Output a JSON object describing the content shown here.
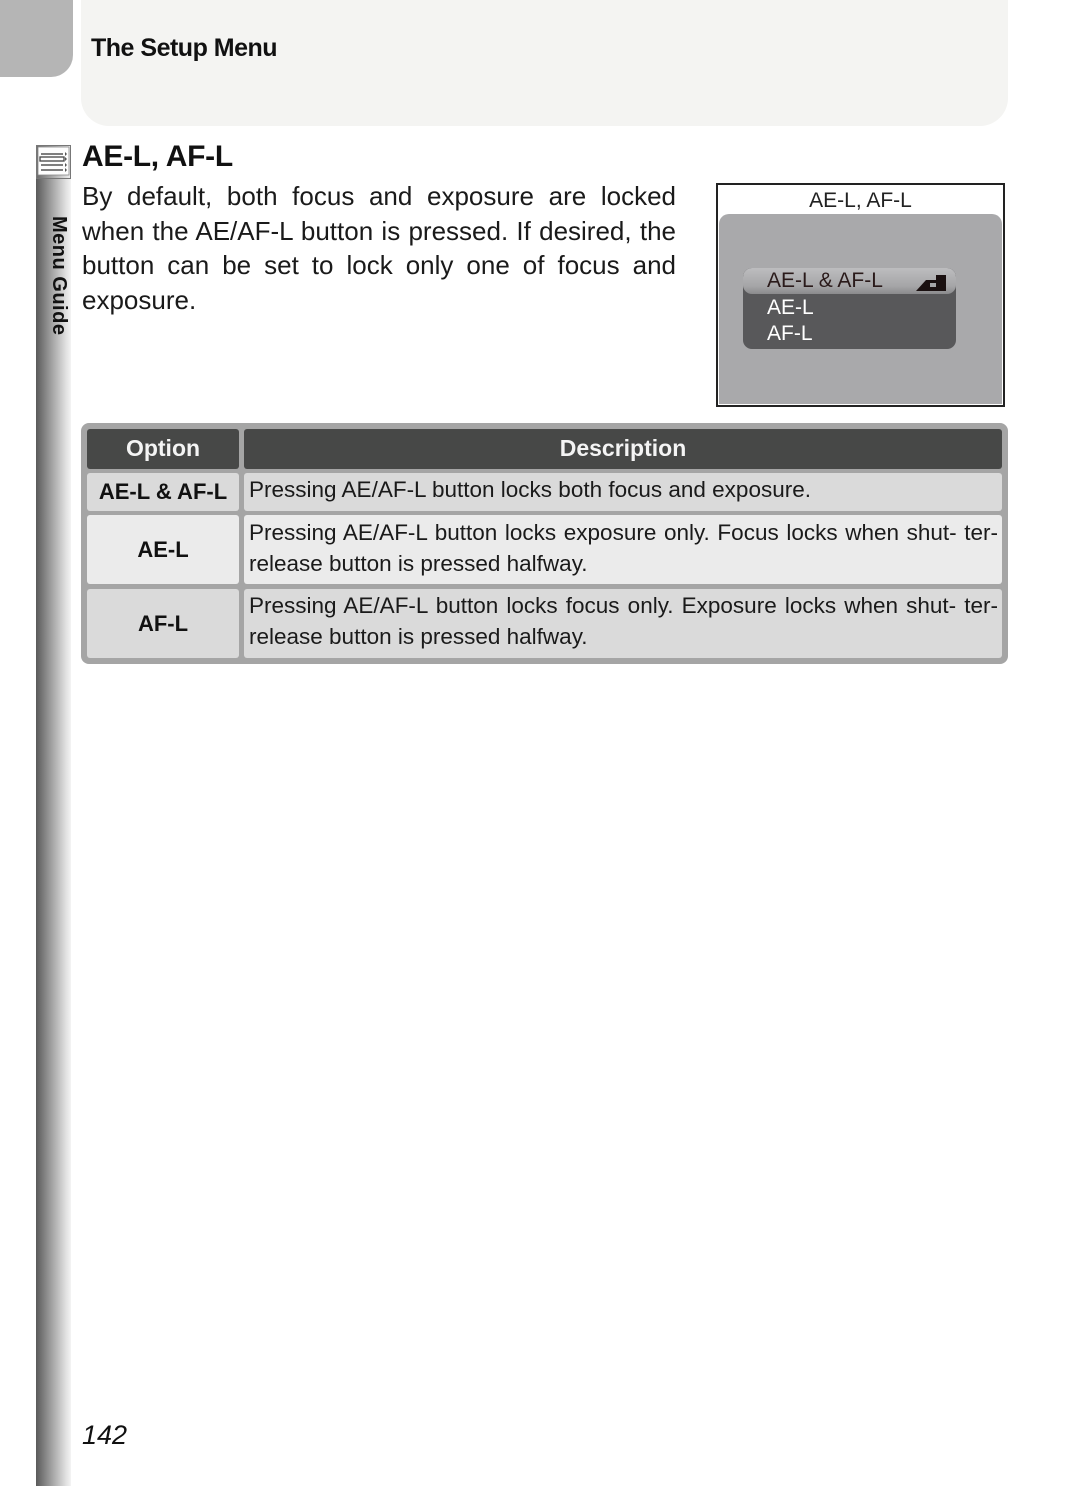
{
  "header": {
    "section": "The Setup Menu"
  },
  "sidebar": {
    "label": "Menu Guide",
    "icon": "menu-list-icon"
  },
  "article": {
    "title": "AE-L, AF-L",
    "intro": "By default, both focus and exposure are locked when the AE/AF-L button is pressed.  If desired, the button can be set to lock only one of focus and exposure."
  },
  "camera_screen": {
    "title": "AE-L, AF-L",
    "options": [
      {
        "label": "AE-L & AF-L",
        "selected": true
      },
      {
        "label": "AE-L",
        "selected": false
      },
      {
        "label": "AF-L",
        "selected": false
      }
    ],
    "selected_icon": "enter-arrow-icon"
  },
  "table": {
    "headers": {
      "option": "Option",
      "description": "Description"
    },
    "rows": [
      {
        "option": "AE-L & AF-L",
        "description": "Pressing AE/AF-L button locks both focus and exposure."
      },
      {
        "option": "AE-L",
        "description": "Pressing AE/AF-L button locks exposure only.  Focus locks when shut- ter-release button is pressed halfway."
      },
      {
        "option": "AF-L",
        "description": "Pressing AE/AF-L button locks focus only.  Exposure locks when shut- ter-release button is pressed halfway."
      }
    ]
  },
  "footer": {
    "page_number": "142"
  }
}
